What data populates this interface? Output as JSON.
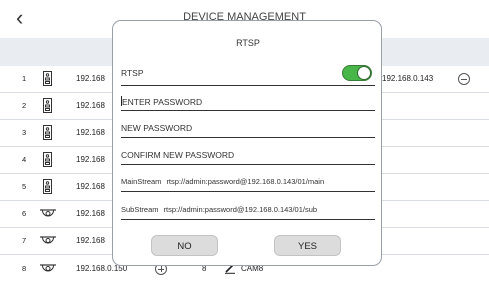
{
  "header": {
    "back_icon": "chevron-left-icon",
    "title": "DEVICE MANAGEMENT"
  },
  "rows": [
    {
      "index": "1",
      "ip": "192.168",
      "right_ip": "192.168.0.143",
      "type": "door-station"
    },
    {
      "index": "2",
      "ip": "192.168",
      "type": "door-station"
    },
    {
      "index": "3",
      "ip": "192.168",
      "type": "door-station"
    },
    {
      "index": "4",
      "ip": "192.168",
      "type": "door-station"
    },
    {
      "index": "5",
      "ip": "192.168",
      "type": "door-station"
    },
    {
      "index": "6",
      "ip": "192.168",
      "type": "camera"
    },
    {
      "index": "7",
      "ip": "192.168",
      "type": "camera"
    },
    {
      "index": "8",
      "ip": "192.168.0.150",
      "channel": "8",
      "camera_name": "CAM8",
      "type": "camera"
    }
  ],
  "dialog": {
    "title": "RTSP",
    "rtsp_label": "RTSP",
    "rtsp_enabled": true,
    "enter_password_placeholder": "ENTER PASSWORD",
    "new_password_placeholder": "NEW PASSWORD",
    "confirm_password_placeholder": "CONFIRM NEW PASSWORD",
    "main_stream_label": "MainStream",
    "main_stream_url": "rtsp://admin:password@192.168.0.143/01/main",
    "sub_stream_label": "SubStream",
    "sub_stream_url": "rtsp://admin:password@192.168.0.143/01/sub",
    "no_label": "NO",
    "yes_label": "YES"
  },
  "colors": {
    "toggle_on": "#49b649",
    "band": "#e9edf2",
    "button": "#dcdcdc"
  }
}
